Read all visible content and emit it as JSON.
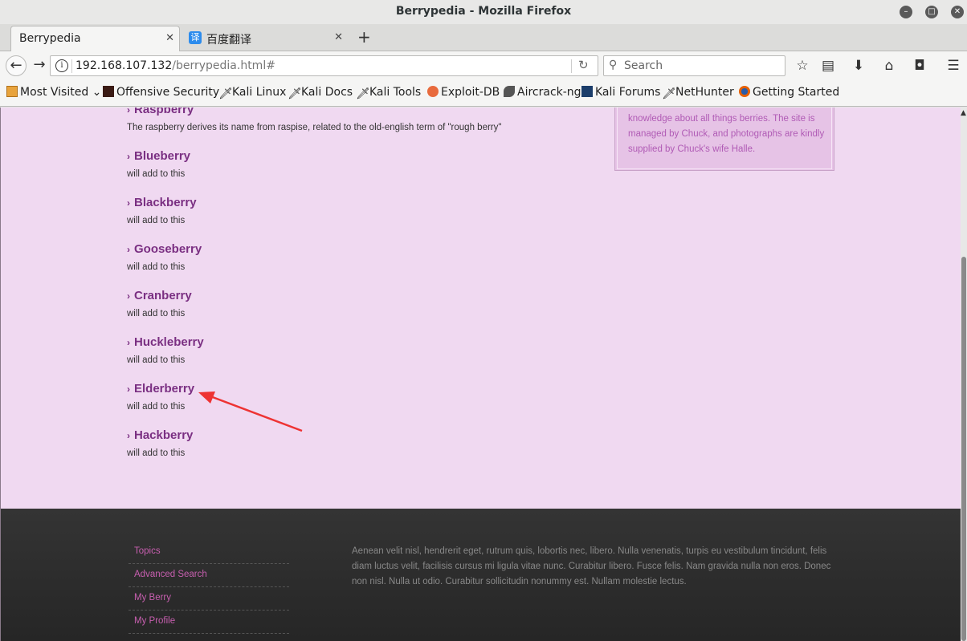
{
  "window": {
    "title": "Berrypedia - Mozilla Firefox"
  },
  "tabs": [
    {
      "label": "Berrypedia"
    },
    {
      "label": "百度翻译",
      "icon": "译"
    }
  ],
  "nav": {
    "url_host": "192.168.107.132",
    "url_path": "/berrypedia.html#",
    "search_placeholder": "Search"
  },
  "bookmarks": [
    {
      "label": "Most Visited",
      "icon": "folder-icon"
    },
    {
      "label": "Offensive Security",
      "icon": "offsec-icon"
    },
    {
      "label": "Kali Linux",
      "icon": "kali-dragon-icon"
    },
    {
      "label": "Kali Docs",
      "icon": "kali-dragon-icon"
    },
    {
      "label": "Kali Tools",
      "icon": "kali-dragon-icon"
    },
    {
      "label": "Exploit-DB",
      "icon": "exploitdb-icon"
    },
    {
      "label": "Aircrack-ng",
      "icon": "aircrack-icon"
    },
    {
      "label": "Kali Forums",
      "icon": "kali-forums-icon"
    },
    {
      "label": "NetHunter",
      "icon": "kali-dragon-icon"
    },
    {
      "label": "Getting Started",
      "icon": "firefox-icon"
    }
  ],
  "berries": [
    {
      "name": "Raspberry",
      "desc": "The raspberry derives its name from raspise, related to the old-english term of \"rough berry\""
    },
    {
      "name": "Blueberry",
      "desc": "will add to this"
    },
    {
      "name": "Blackberry",
      "desc": "will add to this"
    },
    {
      "name": "Gooseberry",
      "desc": "will add to this"
    },
    {
      "name": "Cranberry",
      "desc": "will add to this"
    },
    {
      "name": "Huckleberry",
      "desc": "will add to this"
    },
    {
      "name": "Elderberry",
      "desc": "will add to this"
    },
    {
      "name": "Hackberry",
      "desc": "will add to this"
    }
  ],
  "sidebox": {
    "text": "knowledge about all things berries. The site is managed by Chuck, and photographs are kindly supplied by Chuck's wife Halle."
  },
  "footer": {
    "links": [
      "Topics",
      "Advanced Search",
      "My Berry",
      "My Profile"
    ],
    "text": "Aenean velit nisl, hendrerit eget, rutrum quis, lobortis nec, libero. Nulla venenatis, turpis eu vestibulum tincidunt, felis diam luctus velit, facilisis cursus mi ligula vitae nunc. Curabitur libero. Fusce felis. Nam gravida nulla non eros. Donec non nisl. Nulla ut odio. Curabitur sollicitudin nonummy est. Nullam molestie lectus."
  },
  "colors": {
    "page_bg": "#f0d9f1",
    "heading": "#7a2f82",
    "annotation_arrow": "#ee3333",
    "footer_link": "#c85fb0"
  }
}
